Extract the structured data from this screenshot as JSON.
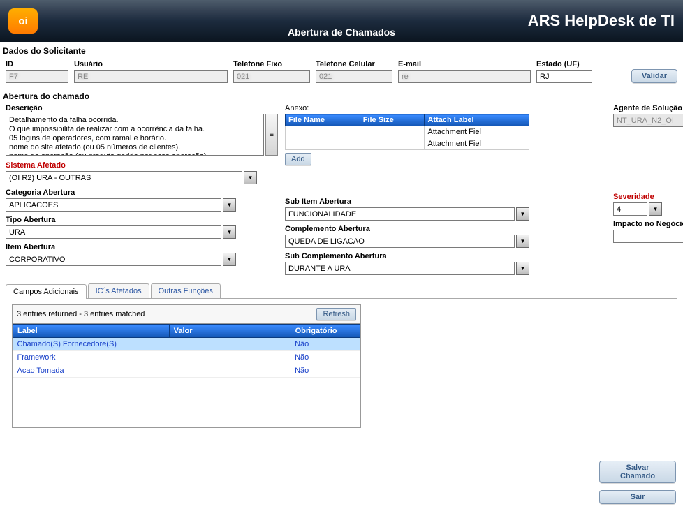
{
  "brand": {
    "logo_text": "oi",
    "app_title": "ARS HelpDesk de TI",
    "subtitle": "Abertura de Chamados"
  },
  "sections": {
    "solicitante": "Dados do Solicitante",
    "abertura": "Abertura do chamado"
  },
  "solicitante": {
    "id_label": "ID",
    "id_value": "F7",
    "user_label": "Usuário",
    "user_value": "RE",
    "tel_fixo_label": "Telefone Fixo",
    "tel_fixo_value": "021",
    "tel_cel_label": "Telefone Celular",
    "tel_cel_value": "021",
    "email_label": "E-mail",
    "email_value": "re",
    "uf_label": "Estado (UF)",
    "uf_value": "RJ",
    "validar_btn": "Validar"
  },
  "descricao": {
    "label": "Descrição",
    "text": "Detalhamento da falha ocorrida.\nO que impossibilita de realizar com a ocorrência da falha.\n05 logins de operadores, com ramal e horário.\nnome do site afetado (ou 05 números de clientes).\nnome da operação (ou produto gerido por essa operação)."
  },
  "anexo": {
    "title": "Anexo:",
    "cols": [
      "File Name",
      "File Size",
      "Attach Label"
    ],
    "rows": [
      {
        "name": "",
        "size": "",
        "label": "Attachment Fiel"
      },
      {
        "name": "",
        "size": "",
        "label": "Attachment Fiel"
      }
    ],
    "add_btn": "Add"
  },
  "agente": {
    "label": "Agente de Solução",
    "value": "NT_URA_N2_OI"
  },
  "combos": {
    "sistema_label": "Sistema Afetado",
    "sistema_value": "(OI R2) URA - OUTRAS",
    "cat_label": "Categoria Abertura",
    "cat_value": "APLICACOES",
    "tipo_label": "Tipo Abertura",
    "tipo_value": "URA",
    "item_label": "Item Abertura",
    "item_value": "CORPORATIVO",
    "subitem_label": "Sub Item Abertura",
    "subitem_value": "FUNCIONALIDADE",
    "comp_label": "Complemento Abertura",
    "comp_value": "QUEDA DE LIGACAO",
    "subcomp_label": "Sub Complemento Abertura",
    "subcomp_value": "DURANTE A URA",
    "sev_label": "Severidade",
    "sev_value": "4",
    "impacto_label": "Impacto no Negócio",
    "impacto_value": ""
  },
  "tabs": {
    "t1": "Campos Adicionais",
    "t2": "IC´s Afetados",
    "t3": "Outras Funções"
  },
  "results": {
    "summary": "3 entries returned - 3 entries matched",
    "refresh_btn": "Refresh",
    "cols": [
      "Label",
      "Valor",
      "Obrigatório"
    ],
    "rows": [
      {
        "label": "Chamado(S) Fornecedore(S)",
        "valor": "",
        "obg": "Não"
      },
      {
        "label": "Framework",
        "valor": "",
        "obg": "Não"
      },
      {
        "label": "Acao Tomada",
        "valor": "",
        "obg": "Não"
      }
    ]
  },
  "footer": {
    "salvar": "Salvar Chamado",
    "sair": "Sair"
  }
}
